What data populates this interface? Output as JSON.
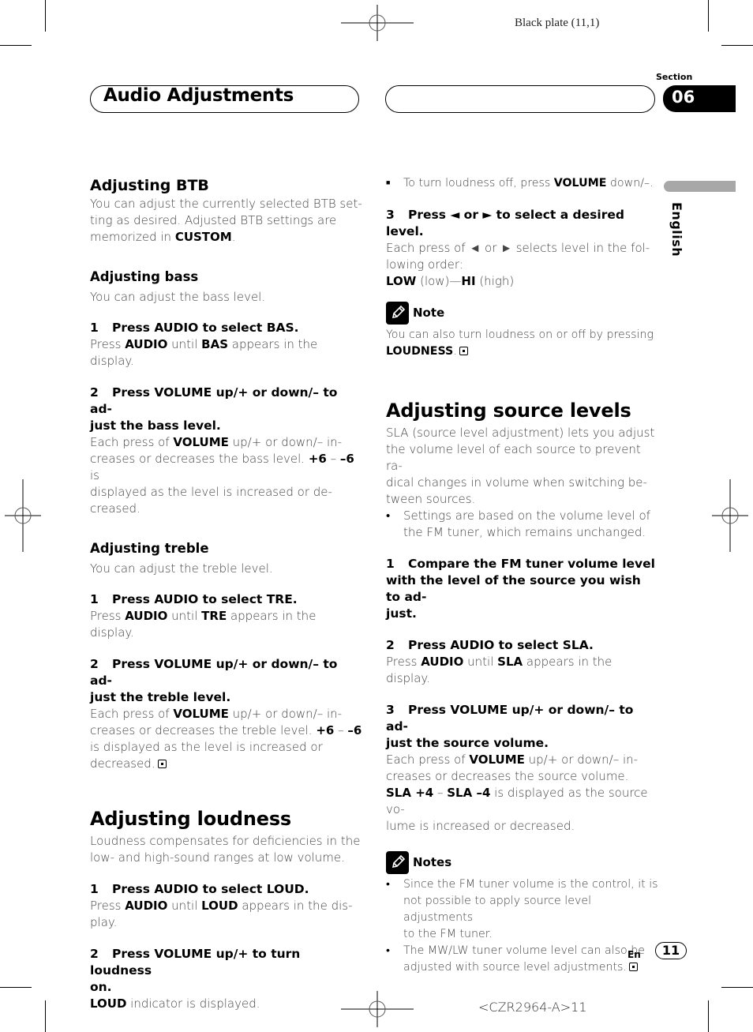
{
  "print": {
    "plate": "Black plate (11,1)",
    "code": "<CZR2964-A>11"
  },
  "header": {
    "title": "Audio Adjustments",
    "section_label": "Section",
    "section_number": "06",
    "language_tab": "English"
  },
  "left": {
    "btb": {
      "title": "Adjusting BTB",
      "body": [
        "You can adjust the currently selected BTB set-",
        "ting as desired. Adjusted BTB settings are",
        "memorized in ",
        "CUSTOM",
        "."
      ]
    },
    "bass": {
      "title": "Adjusting bass",
      "intro": "You can adjust the bass level.",
      "step1": {
        "num": "1",
        "text": "Press AUDIO to select BAS.",
        "body": [
          "Press ",
          "AUDIO",
          " until ",
          "BAS",
          " appears in the display."
        ]
      },
      "step2": {
        "num": "2",
        "text": "Press VOLUME up/+ or down/– to ad-",
        "text2": "just the bass level.",
        "body": [
          "Each press of ",
          "VOLUME",
          " up/+ or down/– in-",
          "creases or decreases the bass level. ",
          "+6",
          " – ",
          "–6",
          " is",
          "displayed as the level is increased or de-",
          "creased."
        ]
      }
    },
    "treble": {
      "title": "Adjusting treble",
      "intro": "You can adjust the treble level.",
      "step1": {
        "num": "1",
        "text": "Press AUDIO to select TRE.",
        "body": [
          "Press ",
          "AUDIO",
          " until ",
          "TRE",
          " appears in the display."
        ]
      },
      "step2": {
        "num": "2",
        "text": "Press VOLUME up/+ or down/– to ad-",
        "text2": "just the treble level.",
        "body": [
          "Each press of ",
          "VOLUME",
          " up/+ or down/– in-",
          "creases or decreases the treble level. ",
          "+6",
          " – ",
          "–6",
          "is displayed as the level is increased or",
          "decreased."
        ]
      }
    },
    "loudness": {
      "title": "Adjusting loudness",
      "intro": [
        "Loudness compensates for deficiencies in the",
        "low- and high-sound ranges at low volume."
      ],
      "step1": {
        "num": "1",
        "text": "Press AUDIO to select LOUD.",
        "body": [
          "Press ",
          "AUDIO",
          " until ",
          "LOUD",
          " appears in the dis-",
          "play."
        ]
      },
      "step2": {
        "num": "2",
        "text": "Press VOLUME up/+ to turn loudness",
        "text2": "on.",
        "body": [
          "LOUD",
          " indicator is displayed."
        ]
      }
    }
  },
  "right": {
    "loud_off": [
      "To turn loudness off, press ",
      "VOLUME",
      " down/–."
    ],
    "step3": {
      "num": "3",
      "text": "Press ◄ or ► to select a desired level.",
      "body": [
        "Each press of ◄ or ► selects level in the fol-",
        "lowing order:"
      ],
      "order": [
        "LOW",
        " (low)—",
        "HI",
        " (high)"
      ]
    },
    "note": {
      "label": "Note",
      "body": [
        "You can also turn loudness on or off by pressing",
        "LOUDNESS",
        "."
      ]
    },
    "source": {
      "title": "Adjusting source levels",
      "intro": [
        "SLA (source level adjustment) lets you adjust",
        "the volume level of each source to prevent ra-",
        "dical changes in volume when switching be-",
        "tween sources."
      ],
      "bullet": [
        "Settings are based on the volume level of",
        "the FM tuner, which remains unchanged."
      ],
      "step1": {
        "num": "1",
        "text": "Compare the FM tuner volume level",
        "text2": "with the level of the source you wish to ad-",
        "text3": "just."
      },
      "step2": {
        "num": "2",
        "text": "Press AUDIO to select SLA.",
        "body": [
          "Press ",
          "AUDIO",
          " until ",
          "SLA",
          " appears in the display."
        ]
      },
      "step3": {
        "num": "3",
        "text": "Press VOLUME up/+ or down/– to ad-",
        "text2": "just the source volume.",
        "body": [
          "Each press of ",
          "VOLUME",
          " up/+ or down/– in-",
          "creases or decreases the source volume.",
          "SLA +4",
          " – ",
          "SLA –4",
          " is displayed as the source vo-",
          "lume is increased or decreased."
        ]
      }
    },
    "notes": {
      "label": "Notes",
      "items": [
        [
          "Since the FM tuner volume is the control, it is",
          "not possible to apply source level adjustments",
          "to the FM tuner."
        ],
        [
          "The MW/LW tuner volume level can also be",
          "adjusted with source level adjustments."
        ]
      ]
    }
  },
  "footer": {
    "lang": "En",
    "page": "11"
  }
}
